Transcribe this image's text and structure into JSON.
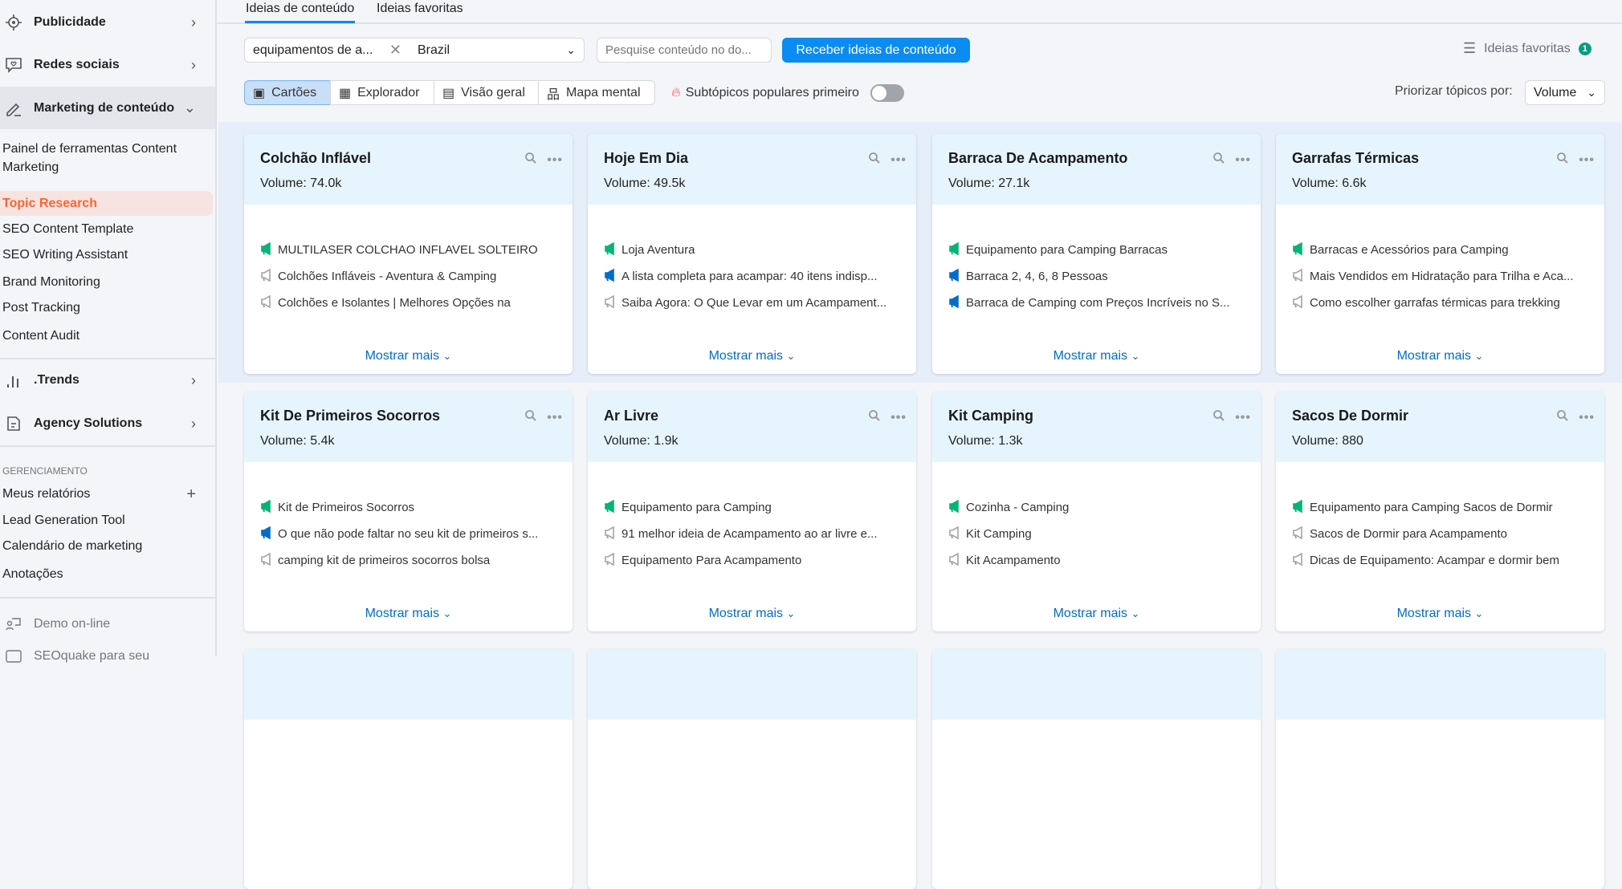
{
  "sidebar": {
    "main_items": [
      {
        "label": "Publicidade",
        "icon": "target-icon"
      },
      {
        "label": "Redes sociais",
        "icon": "chat-icon"
      },
      {
        "label": "Marketing de conteúdo",
        "icon": "pencil-icon"
      }
    ],
    "sub_items": [
      "Painel de ferramentas Content Marketing",
      "Topic Research",
      "SEO Content Template",
      "SEO Writing Assistant",
      "Brand Monitoring",
      "Post Tracking",
      "Content Audit"
    ],
    "trends": ".Trends",
    "agency": "Agency Solutions",
    "section": "GERENCIAMENTO",
    "manage": [
      "Meus relatórios",
      "Lead Generation Tool",
      "Calendário de marketing",
      "Anotações"
    ],
    "demo": "Demo on-line",
    "seoquake": "SEOquake para seu"
  },
  "tabs": [
    "Ideias de conteúdo",
    "Ideias favoritas"
  ],
  "search": {
    "query": "equipamentos de a...",
    "country": "Brazil",
    "domain_placeholder": "Pesquise conteúdo no do...",
    "submit": "Receber ideias de conteúdo"
  },
  "favorites": {
    "label": "Ideias favoritas",
    "count": "1"
  },
  "views": [
    "Cartões",
    "Explorador",
    "Visão geral",
    "Mapa mental"
  ],
  "popular_toggle": {
    "label": "Subtópicos populares primeiro",
    "on": false
  },
  "sort": {
    "label": "Priorizar tópicos por:",
    "value": "Volume"
  },
  "show_more": "Mostrar mais",
  "colors": {
    "green": "#00b578",
    "blue": "#006dca",
    "gray": "#a0a4ab",
    "accent": "#ff642d"
  },
  "cards": [
    {
      "title": "Colchão Inflável",
      "volume": "Volume: 74.0k",
      "items": [
        {
          "text": "MULTILASER COLCHAO INFLAVEL SOLTEIRO",
          "type": "green"
        },
        {
          "text": "Colchões Infláveis - Aventura & Camping",
          "type": "gray"
        },
        {
          "text": "Colchões e Isolantes | Melhores Opções na",
          "type": "gray"
        }
      ]
    },
    {
      "title": "Hoje Em Dia",
      "volume": "Volume: 49.5k",
      "items": [
        {
          "text": "Loja Aventura",
          "type": "green"
        },
        {
          "text": "A lista completa para acampar: 40 itens indisp...",
          "type": "blue"
        },
        {
          "text": "Saiba Agora: O Que Levar em um Acampament...",
          "type": "gray"
        }
      ]
    },
    {
      "title": "Barraca De Acampamento",
      "volume": "Volume: 27.1k",
      "items": [
        {
          "text": "Equipamento para Camping Barracas",
          "type": "green"
        },
        {
          "text": "Barraca 2, 4, 6, 8 Pessoas",
          "type": "blue"
        },
        {
          "text": "Barraca de Camping com Preços Incríveis no S...",
          "type": "blue"
        }
      ]
    },
    {
      "title": "Garrafas Térmicas",
      "volume": "Volume: 6.6k",
      "items": [
        {
          "text": "Barracas e Acessórios para Camping",
          "type": "green"
        },
        {
          "text": "Mais Vendidos em Hidratação para Trilha e Aca...",
          "type": "gray"
        },
        {
          "text": "Como escolher garrafas térmicas para trekking",
          "type": "gray"
        }
      ]
    },
    {
      "title": "Kit De Primeiros Socorros",
      "volume": "Volume: 5.4k",
      "items": [
        {
          "text": "Kit de Primeiros Socorros",
          "type": "green"
        },
        {
          "text": "O que não pode faltar no seu kit de primeiros s...",
          "type": "blue"
        },
        {
          "text": "camping kit de primeiros socorros bolsa",
          "type": "gray"
        }
      ]
    },
    {
      "title": "Ar Livre",
      "volume": "Volume: 1.9k",
      "items": [
        {
          "text": "Equipamento para Camping",
          "type": "green"
        },
        {
          "text": "91 melhor ideia de Acampamento ao ar livre e...",
          "type": "gray"
        },
        {
          "text": "Equipamento Para Acampamento",
          "type": "gray"
        }
      ]
    },
    {
      "title": "Kit Camping",
      "volume": "Volume: 1.3k",
      "items": [
        {
          "text": "Cozinha - Camping",
          "type": "green"
        },
        {
          "text": "Kit Camping",
          "type": "gray"
        },
        {
          "text": "Kit Acampamento",
          "type": "gray"
        }
      ]
    },
    {
      "title": "Sacos De Dormir",
      "volume": "Volume: 880",
      "items": [
        {
          "text": "Equipamento para Camping Sacos de Dormir",
          "type": "green"
        },
        {
          "text": "Sacos de Dormir para Acampamento",
          "type": "gray"
        },
        {
          "text": "Dicas de Equipamento: Acampar e dormir bem",
          "type": "gray"
        }
      ]
    }
  ]
}
